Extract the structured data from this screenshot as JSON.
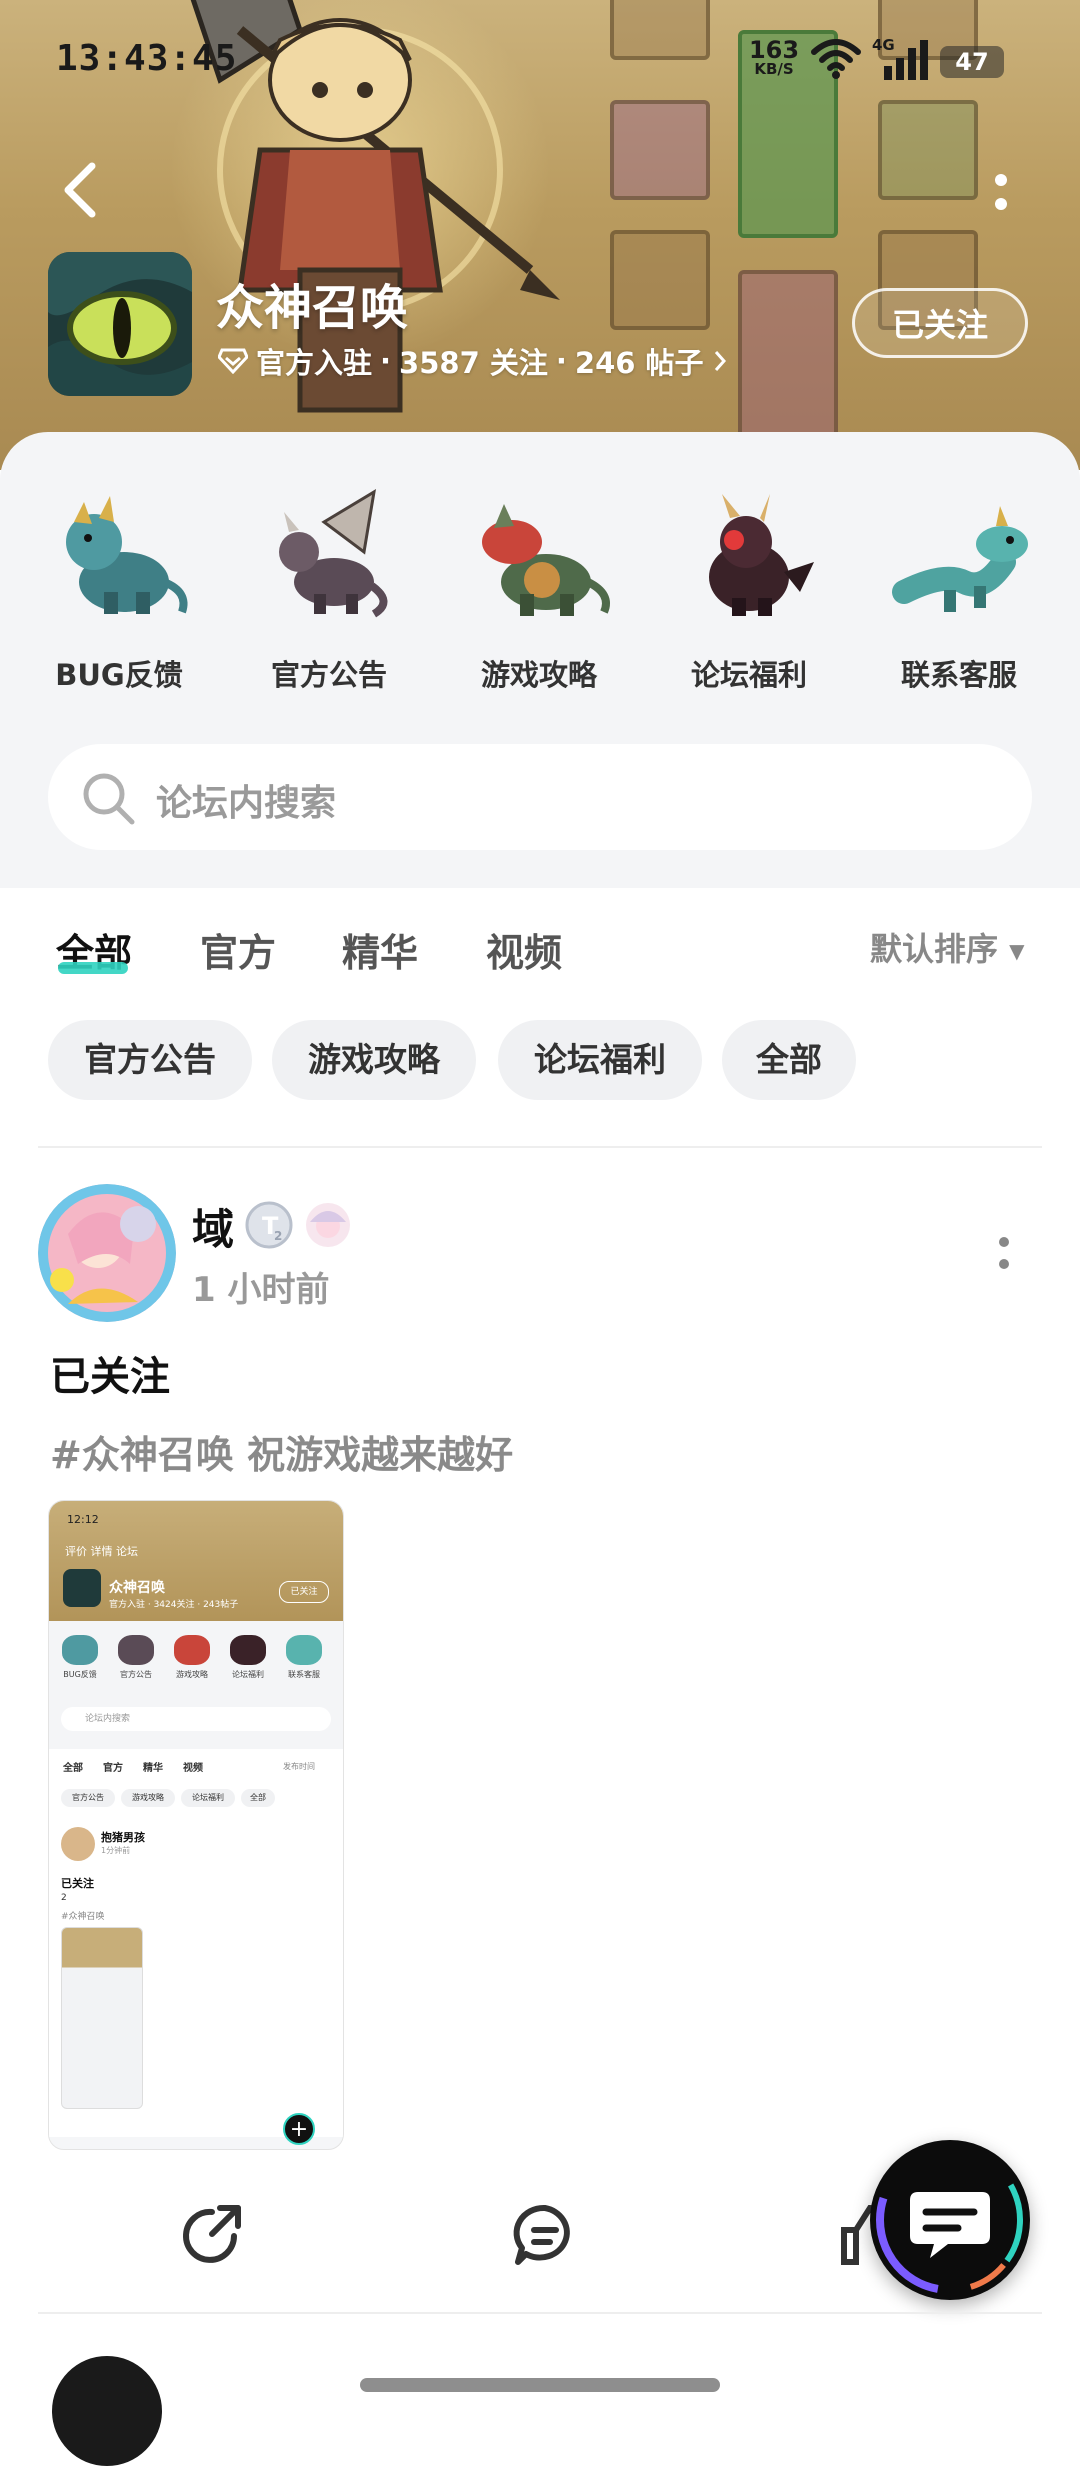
{
  "status_bar": {
    "time": "13:43:45",
    "net_speed_value": "163",
    "net_speed_unit": "KB/S",
    "network_type": "4G",
    "battery": "47"
  },
  "header": {
    "game_title": "众神召唤",
    "meta_official": "官方入驻",
    "meta_followers": "3587 关注",
    "meta_posts": "246 帖子",
    "meta_sep": "·",
    "follow_label": "已关注"
  },
  "shortcuts": [
    {
      "label": "BUG反馈",
      "icon": "teal-dragon-icon"
    },
    {
      "label": "官方公告",
      "icon": "winged-dragon-icon"
    },
    {
      "label": "游戏攻略",
      "icon": "red-dragon-icon"
    },
    {
      "label": "论坛福利",
      "icon": "dark-dragon-icon"
    },
    {
      "label": "联系客服",
      "icon": "serpent-dragon-icon"
    }
  ],
  "search": {
    "placeholder": "论坛内搜索"
  },
  "tabs": [
    {
      "label": "全部",
      "active": true
    },
    {
      "label": "官方",
      "active": false
    },
    {
      "label": "精华",
      "active": false
    },
    {
      "label": "视频",
      "active": false
    }
  ],
  "sort_label": "默认排序",
  "chips": [
    "官方公告",
    "游戏攻略",
    "论坛福利",
    "全部"
  ],
  "post": {
    "user": "域",
    "time": "1 小时前",
    "title": "已关注",
    "tag": "#众神召唤 祝游戏越来越好",
    "embedded_screenshot": {
      "time": "12:12",
      "nav": "评价  详情  论坛",
      "title": "众神召唤",
      "meta": "官方入驻 · 3424关注 · 243帖子",
      "follow": "已关注",
      "shortcuts": [
        "BUG反馈",
        "官方公告",
        "游戏攻略",
        "论坛福利",
        "联系客服"
      ],
      "search": "论坛内搜索",
      "tabs": [
        "全部",
        "官方",
        "精华",
        "视频"
      ],
      "sort": "发布时间",
      "chips": [
        "官方公告",
        "游戏攻略",
        "论坛福利",
        "全部"
      ],
      "user": "抱猪男孩",
      "time_ago": "1分钟前",
      "post_title": "已关注",
      "post_body": "2",
      "post_tag": "#众神召唤"
    }
  },
  "colors": {
    "accent": "#2fd3c0",
    "header_bg": "#b99b5f",
    "panel_bg": "#f4f5f7"
  }
}
